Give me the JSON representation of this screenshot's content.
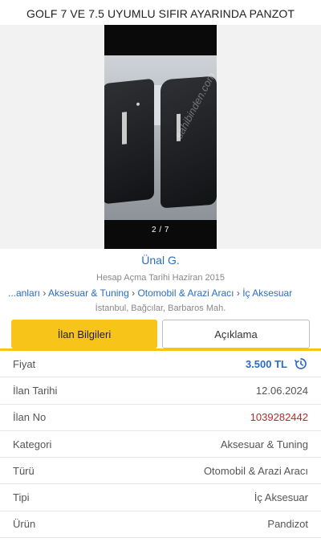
{
  "header": {
    "title": "GOLF 7 VE 7.5 UYUMLU SIFIR AYARINDA PANZOT"
  },
  "gallery": {
    "counter": "2 / 7",
    "watermark": "sahibinden.com"
  },
  "seller": {
    "name": "Ünal G.",
    "since": "Hesap Açma Tarihi Haziran 2015"
  },
  "breadcrumb": {
    "items": [
      "...anları",
      "Aksesuar & Tuning",
      "Otomobil & Arazi Aracı",
      "İç Aksesuar"
    ],
    "separator": "›"
  },
  "location": "İstanbul, Bağcılar, Barbaros Mah.",
  "tabs": [
    {
      "label": "İlan Bilgileri",
      "active": true
    },
    {
      "label": "Açıklama",
      "active": false
    }
  ],
  "details": [
    {
      "label": "Fiyat",
      "value": "3.500 TL"
    },
    {
      "label": "İlan Tarihi",
      "value": "12.06.2024"
    },
    {
      "label": "İlan No",
      "value": "1039282442"
    },
    {
      "label": "Kategori",
      "value": "Aksesuar & Tuning"
    },
    {
      "label": "Türü",
      "value": "Otomobil & Arazi Aracı"
    },
    {
      "label": "Tipi",
      "value": "İç Aksesuar"
    },
    {
      "label": "Ürün",
      "value": "Pandizot"
    }
  ],
  "colors": {
    "accent": "#f7c51a",
    "link": "#2a6cc4",
    "listing_no": "#c0262d"
  }
}
